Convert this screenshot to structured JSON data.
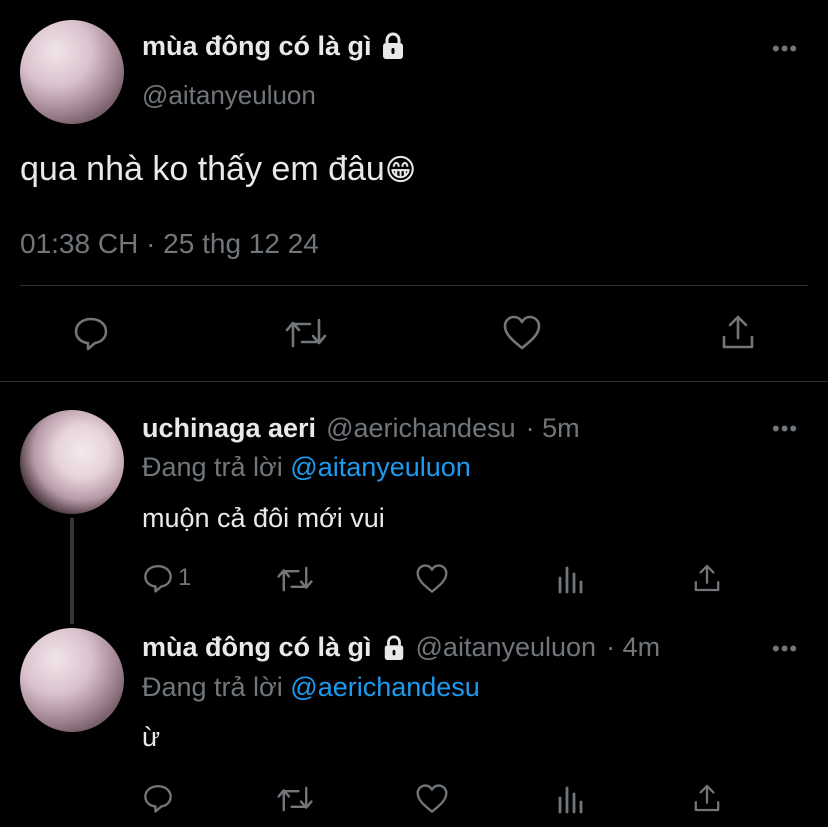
{
  "main_tweet": {
    "display_name": "mùa đông có là gì",
    "handle": "@aitanyeuluon",
    "text": "qua nhà ko thấy em đâu",
    "emoji": "😁",
    "timestamp": "01:38 CH · 25 thg 12 24",
    "more_label": "•••"
  },
  "replies": [
    {
      "display_name": "uchinaga aeri",
      "handle": "@aerichandesu",
      "time": "· 5m",
      "replying_prefix": "Đang trả lời",
      "replying_to": "@aitanyeuluon",
      "text": "muộn cả đôi mới vui",
      "reply_count": "1",
      "more_label": "•••"
    },
    {
      "display_name": "mùa đông có là gì",
      "handle": "@aitanyeuluon",
      "time": "· 4m",
      "replying_prefix": "Đang trả lời",
      "replying_to": "@aerichandesu",
      "text": "ừ",
      "more_label": "•••"
    }
  ],
  "icons": {
    "lock": "lock-icon",
    "reply": "reply-icon",
    "retweet": "retweet-icon",
    "like": "like-icon",
    "share": "share-icon",
    "views": "views-icon"
  },
  "colors": {
    "background": "#000000",
    "text": "#e7e9ea",
    "muted": "#71767b",
    "link": "#1d9bf0"
  }
}
